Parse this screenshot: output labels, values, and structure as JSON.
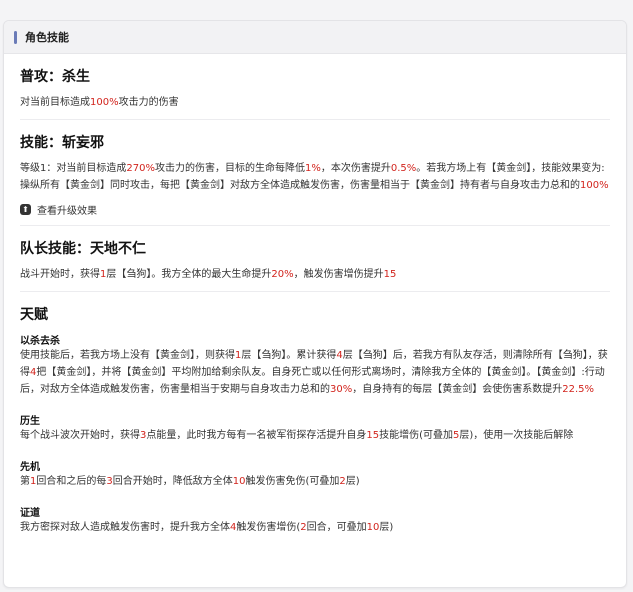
{
  "header": {
    "title": "角色技能"
  },
  "normal": {
    "title": "普攻：杀生",
    "desc": [
      "对当前目标造成",
      "100%",
      "攻击力的伤害"
    ]
  },
  "skill": {
    "title": "技能：斩妄邪",
    "desc": [
      "等级1：对当前目标造成",
      "270%",
      "攻击力的伤害，目标的生命每降低",
      "1%",
      "，本次伤害提升",
      "0.5%",
      "。若我方场上有【黄金剑】，技能效果变为:操纵所有【黄金剑】同时攻击，每把【黄金剑】对敌方全体造成触发伤害，伤害量相当于【黄金剑】持有者与自身攻击力总和的",
      "100%",
      ""
    ],
    "upgrade_label": "查看升级效果"
  },
  "leader": {
    "title": "队长技能：天地不仁",
    "desc": [
      "战斗开始时，获得",
      "1",
      "层【刍狗】。我方全体的最大生命提升",
      "20%",
      "，触发伤害增伤提升",
      "15",
      ""
    ]
  },
  "talents": {
    "title": "天赋",
    "items": [
      {
        "name": "以杀去杀",
        "desc": [
          "使用技能后，若我方场上没有【黄金剑】，则获得",
          "1",
          "层【刍狗】。累计获得",
          "4",
          "层【刍狗】后，若我方有队友存活，则清除所有【刍狗】，获得",
          "4",
          "把【黄金剑】，并将【黄金剑】平均附加给剩余队友。自身死亡或以任何形式离场时，清除我方全体的【黄金剑】。【黄金剑】:行动后，对敌方全体造成触发伤害，伤害量相当于安期与自身攻击力总和的",
          "30%",
          "，自身持有的每层【黄金剑】会使伤害系数提升",
          "22.5%",
          ""
        ]
      },
      {
        "name": "历生",
        "desc": [
          "每个战斗波次开始时，获得",
          "3",
          "点能量，此时我方每有一名被军衔探存活提升自身",
          "15",
          "技能增伤(可叠加",
          "5",
          "层)，使用一次技能后解除"
        ]
      },
      {
        "name": "先机",
        "desc": [
          "第",
          "1",
          "回合和之后的每",
          "3",
          "回合开始时，降低敌方全体",
          "10",
          "触发伤害免伤(可叠加",
          "2",
          "层)"
        ]
      },
      {
        "name": "证道",
        "desc": [
          "我方密探对敌人造成触发伤害时，提升我方全体",
          "4",
          "触发伤害增伤(",
          "2",
          "回合，可叠加",
          "10",
          "层)"
        ]
      }
    ]
  },
  "colors": {
    "highlight": "#d2241d",
    "accent_bar": "#6a7bb7"
  }
}
